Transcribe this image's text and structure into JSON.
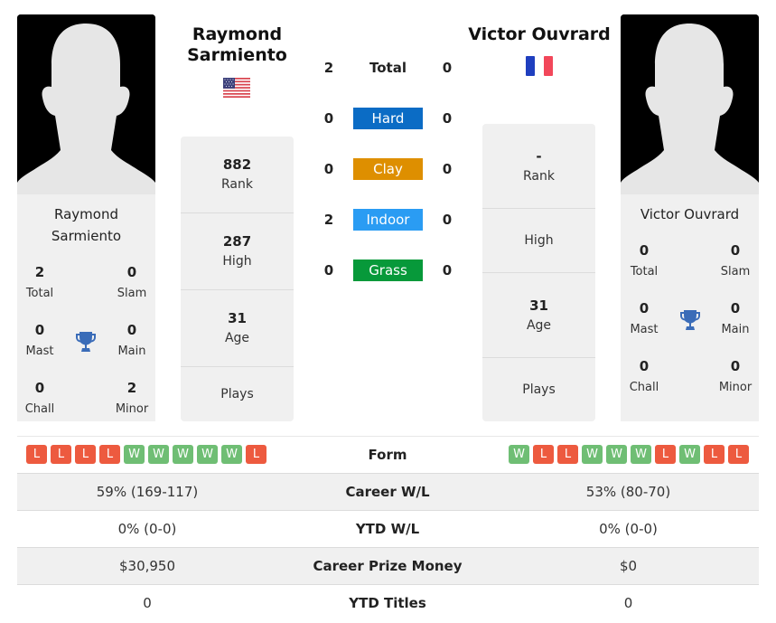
{
  "colors": {
    "hard": "#0b6cc5",
    "clay": "#de8f00",
    "indoor": "#2a9cf3",
    "grass": "#07993a",
    "win": "#6fbe74",
    "loss": "#ed5a3f",
    "trophy": "#3a6cb8"
  },
  "player1": {
    "name": "Raymond Sarmiento",
    "name_line1": "Raymond",
    "name_line2": "Sarmiento",
    "flag_icon": "us-flag-icon",
    "titles": {
      "total": {
        "value": "2",
        "label": "Total"
      },
      "slam": {
        "value": "0",
        "label": "Slam"
      },
      "mast": {
        "value": "0",
        "label": "Mast"
      },
      "main": {
        "value": "0",
        "label": "Main"
      },
      "chall": {
        "value": "0",
        "label": "Chall"
      },
      "minor": {
        "value": "2",
        "label": "Minor"
      }
    },
    "stats": {
      "rank": {
        "value": "882",
        "label": "Rank"
      },
      "high": {
        "value": "287",
        "label": "High"
      },
      "age": {
        "value": "31",
        "label": "Age"
      },
      "plays": {
        "value": "",
        "label": "Plays"
      }
    },
    "form": [
      "L",
      "L",
      "L",
      "L",
      "W",
      "W",
      "W",
      "W",
      "W",
      "L"
    ]
  },
  "player2": {
    "name": "Victor Ouvrard",
    "flag_icon": "france-flag-icon",
    "titles": {
      "total": {
        "value": "0",
        "label": "Total"
      },
      "slam": {
        "value": "0",
        "label": "Slam"
      },
      "mast": {
        "value": "0",
        "label": "Mast"
      },
      "main": {
        "value": "0",
        "label": "Main"
      },
      "chall": {
        "value": "0",
        "label": "Chall"
      },
      "minor": {
        "value": "0",
        "label": "Minor"
      }
    },
    "stats": {
      "rank": {
        "value": "-",
        "label": "Rank"
      },
      "high": {
        "value": "",
        "label": "High"
      },
      "age": {
        "value": "31",
        "label": "Age"
      },
      "plays": {
        "value": "",
        "label": "Plays"
      }
    },
    "form": [
      "W",
      "L",
      "L",
      "W",
      "W",
      "W",
      "L",
      "W",
      "L",
      "L"
    ]
  },
  "h2h": [
    {
      "key": "total",
      "label": "Total",
      "p1": "2",
      "p2": "0"
    },
    {
      "key": "hard",
      "label": "Hard",
      "p1": "0",
      "p2": "0"
    },
    {
      "key": "clay",
      "label": "Clay",
      "p1": "0",
      "p2": "0"
    },
    {
      "key": "indoor",
      "label": "Indoor",
      "p1": "2",
      "p2": "0"
    },
    {
      "key": "grass",
      "label": "Grass",
      "p1": "0",
      "p2": "0"
    }
  ],
  "form_label": "Form",
  "comparison": [
    {
      "label": "Career W/L",
      "p1": "59% (169-117)",
      "p2": "53% (80-70)"
    },
    {
      "label": "YTD W/L",
      "p1": "0% (0-0)",
      "p2": "0% (0-0)"
    },
    {
      "label": "Career Prize Money",
      "p1": "$30,950",
      "p2": "$0"
    },
    {
      "label": "YTD Titles",
      "p1": "0",
      "p2": "0"
    }
  ]
}
